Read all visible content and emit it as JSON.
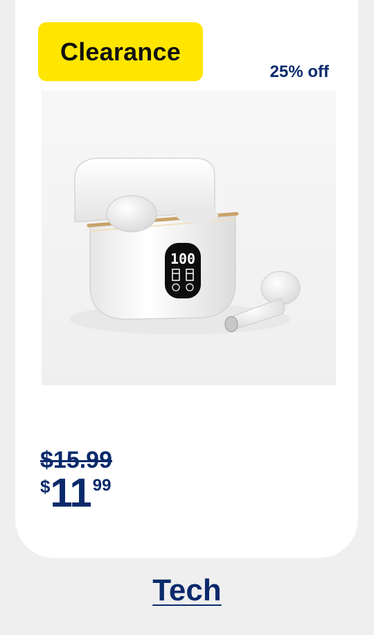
{
  "badge": {
    "label": "Clearance",
    "color": "#ffe600"
  },
  "discount": {
    "label": "25% off"
  },
  "product": {
    "image_subject": "white wireless earbuds with LED charging case",
    "case_display": "100"
  },
  "price": {
    "was": "$15.99",
    "currency": "$",
    "dollars": "11",
    "cents": "99"
  },
  "category": {
    "label": "Tech"
  },
  "colors": {
    "accent_text": "#0a2a6b",
    "badge_bg": "#ffe600",
    "page_bg": "#efefef",
    "card_bg": "#ffffff"
  }
}
